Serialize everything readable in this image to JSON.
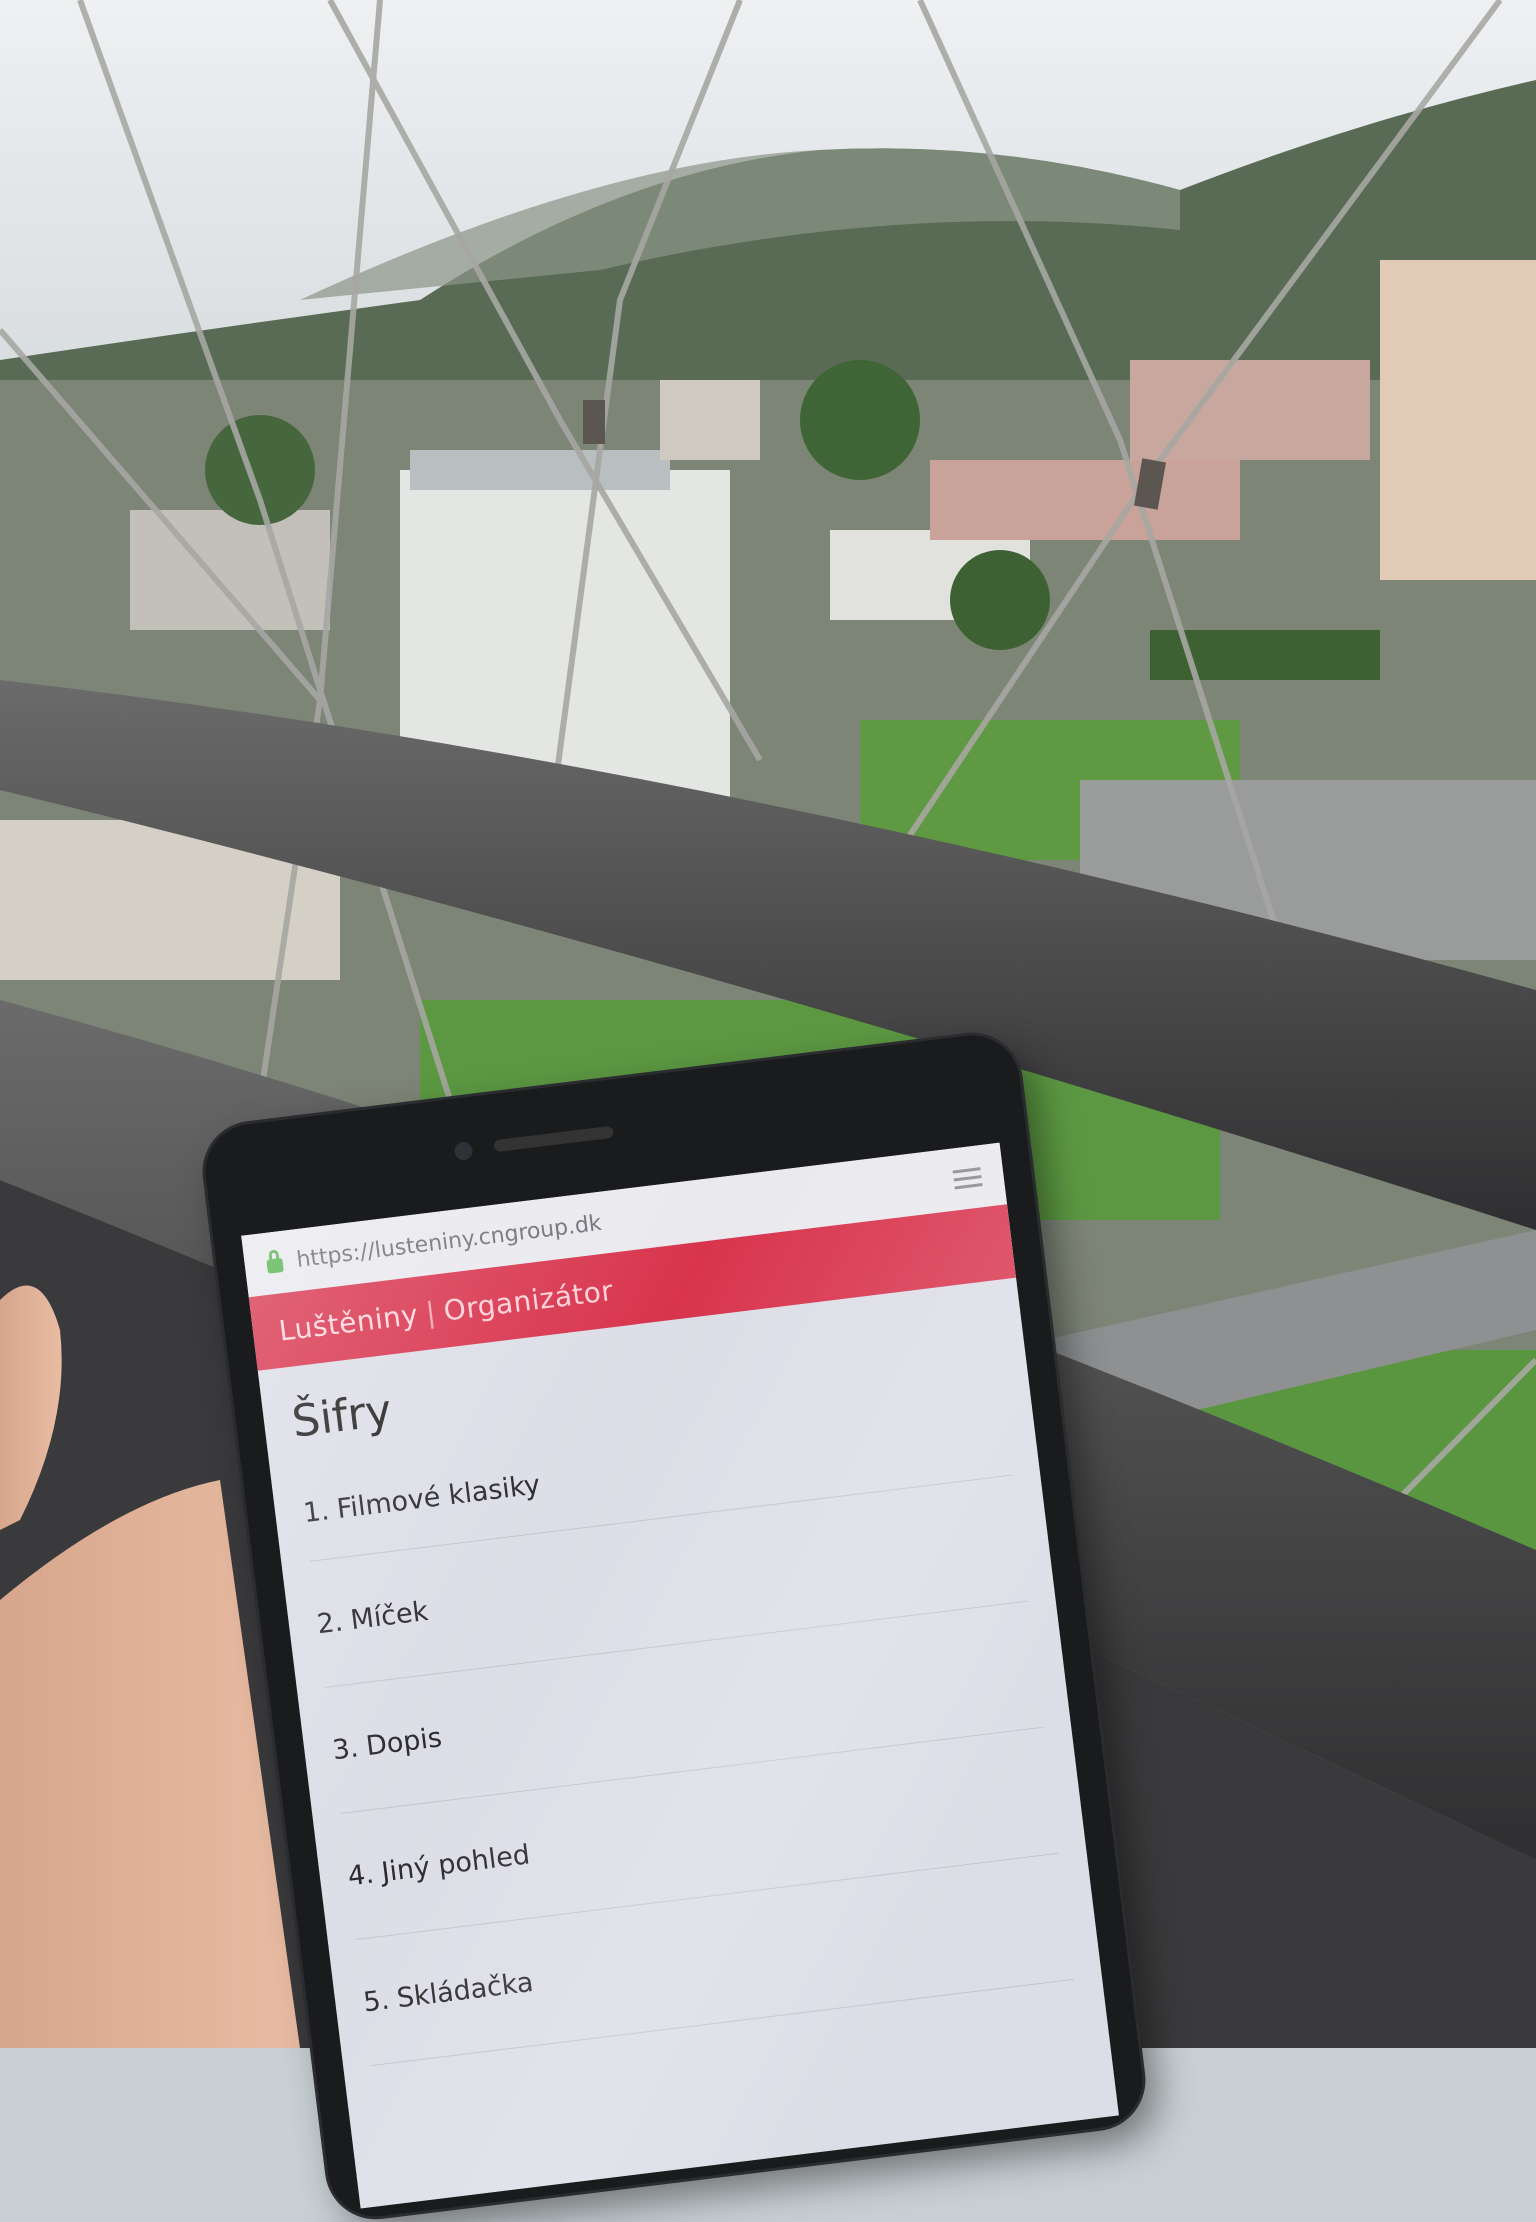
{
  "phone": {
    "url": "https://lusteniny.cngroup.dk",
    "header": {
      "brand": "Luštěniny",
      "separator": "|",
      "role": "Organizátor"
    },
    "page_title": "Šifry",
    "ciphers": [
      {
        "number": "1.",
        "name": "Filmové klasiky"
      },
      {
        "number": "2.",
        "name": "Míček"
      },
      {
        "number": "3.",
        "name": "Dopis"
      },
      {
        "number": "4.",
        "name": "Jiný pohled"
      },
      {
        "number": "5.",
        "name": "Skládačka"
      }
    ]
  },
  "colors": {
    "header": "#d8344d",
    "lock": "#57b44f",
    "screen": "#dcdde6",
    "phone_body": "#1a1b1d"
  }
}
